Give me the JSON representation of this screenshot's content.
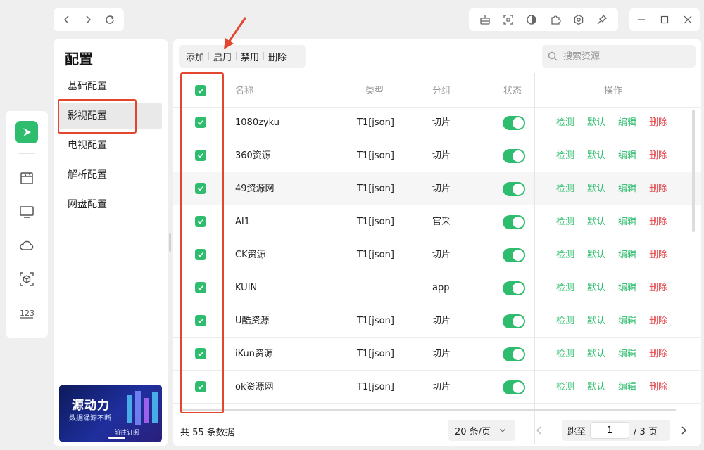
{
  "sidebar": {
    "title": "配置",
    "items": [
      "基础配置",
      "影视配置",
      "电视配置",
      "解析配置",
      "网盘配置"
    ],
    "active_index": 1,
    "banner": {
      "title": "源动力",
      "subtitle": "数据涌源不断",
      "button": "前往订阅"
    }
  },
  "rail": {
    "icons": [
      "app-logo-icon",
      "film-icon",
      "tv-icon",
      "cloud-icon",
      "cube-scan-icon",
      "numbers-icon"
    ]
  },
  "topbar": {
    "nav_icons": [
      "back-icon",
      "forward-icon",
      "refresh-icon"
    ],
    "tool_icons": [
      "robot-icon",
      "qrcode-icon",
      "theme-icon",
      "puzzle-icon",
      "settings-icon",
      "pin-icon"
    ],
    "window_icons": [
      "minimize-icon",
      "maximize-icon",
      "close-icon"
    ]
  },
  "toolbar": {
    "add": "添加",
    "enable": "启用",
    "disable": "禁用",
    "delete": "删除"
  },
  "search": {
    "placeholder": "搜索资源"
  },
  "table": {
    "columns": {
      "name": "名称",
      "type": "类型",
      "group": "分组",
      "status": "状态",
      "ops": "操作"
    },
    "op_labels": {
      "check": "检测",
      "default": "默认",
      "edit": "编辑",
      "delete": "删除"
    },
    "rows": [
      {
        "name": "1080zyku",
        "type": "T1[json]",
        "group": "切片",
        "checked": true,
        "enabled": true
      },
      {
        "name": "360资源",
        "type": "T1[json]",
        "group": "切片",
        "checked": true,
        "enabled": true
      },
      {
        "name": "49资源网",
        "type": "T1[json]",
        "group": "切片",
        "checked": true,
        "enabled": true
      },
      {
        "name": "AI1",
        "type": "T1[json]",
        "group": "官采",
        "checked": true,
        "enabled": true
      },
      {
        "name": "CK资源",
        "type": "T1[json]",
        "group": "切片",
        "checked": true,
        "enabled": true
      },
      {
        "name": "KUIN",
        "type": "",
        "group": "app",
        "checked": true,
        "enabled": true
      },
      {
        "name": "U酷资源",
        "type": "T1[json]",
        "group": "切片",
        "checked": true,
        "enabled": true
      },
      {
        "name": "iKun资源",
        "type": "T1[json]",
        "group": "切片",
        "checked": true,
        "enabled": true
      },
      {
        "name": "ok资源网",
        "type": "T1[json]",
        "group": "切片",
        "checked": true,
        "enabled": true
      }
    ]
  },
  "footer": {
    "total": "共 55 条数据",
    "page_size": "20 条/页",
    "jump_label": "跳至",
    "page_value": "1",
    "total_pages": "/ 3 页"
  },
  "colors": {
    "accent": "#2ebd6e",
    "danger": "#e5484d",
    "annotation": "#e3452e"
  }
}
